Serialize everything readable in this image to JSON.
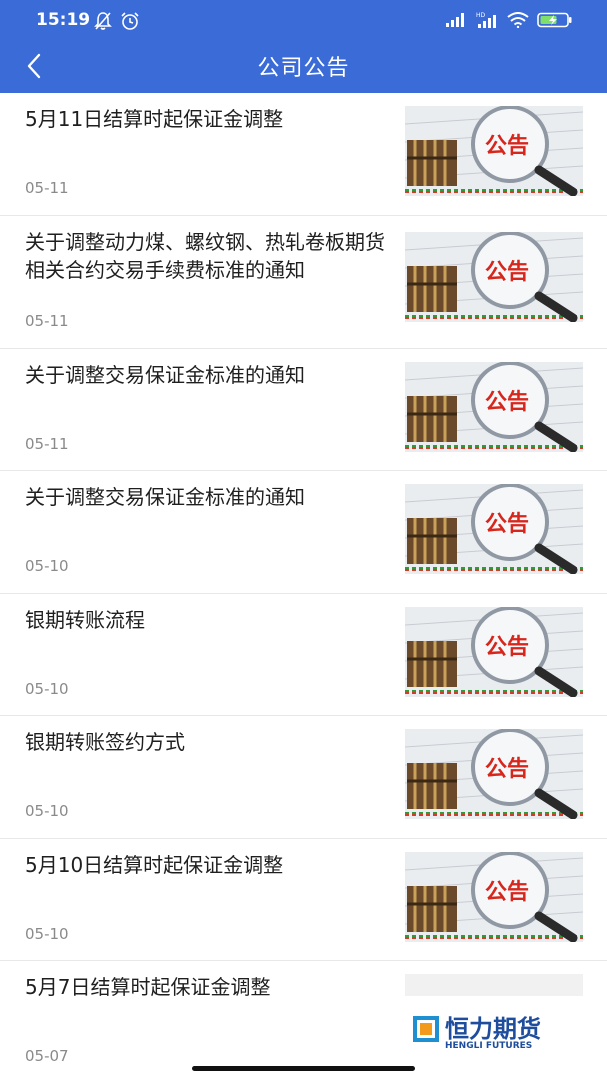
{
  "status": {
    "time": "15:19",
    "battery": "charging"
  },
  "header": {
    "title": "公司公告",
    "back_icon": "chevron-left-icon"
  },
  "theme": {
    "accent": "#3a6bd6",
    "thumb_label_color": "#d7261b"
  },
  "announcements": [
    {
      "title": "5月11日结算时起保证金调整",
      "date": "05-11",
      "thumb": "announcement-magnifier",
      "thumb_text": "公告"
    },
    {
      "title": "关于调整动力煤、螺纹钢、热轧卷板期货相关合约交易手续费标准的通知",
      "date": "05-11",
      "thumb": "announcement-magnifier",
      "thumb_text": "公告"
    },
    {
      "title": "关于调整交易保证金标准的通知",
      "date": "05-11",
      "thumb": "announcement-magnifier",
      "thumb_text": "公告"
    },
    {
      "title": "关于调整交易保证金标准的通知",
      "date": "05-10",
      "thumb": "announcement-magnifier",
      "thumb_text": "公告"
    },
    {
      "title": "银期转账流程",
      "date": "05-10",
      "thumb": "announcement-magnifier",
      "thumb_text": "公告"
    },
    {
      "title": "银期转账签约方式",
      "date": "05-10",
      "thumb": "announcement-magnifier",
      "thumb_text": "公告"
    },
    {
      "title": "5月10日结算时起保证金调整",
      "date": "05-10",
      "thumb": "announcement-magnifier",
      "thumb_text": "公告"
    },
    {
      "title": "5月7日结算时起保证金调整",
      "date": "05-07",
      "thumb": "hengli-logo",
      "logo_cn": "恒力期货",
      "logo_en": "HENGLI FUTURES"
    }
  ]
}
